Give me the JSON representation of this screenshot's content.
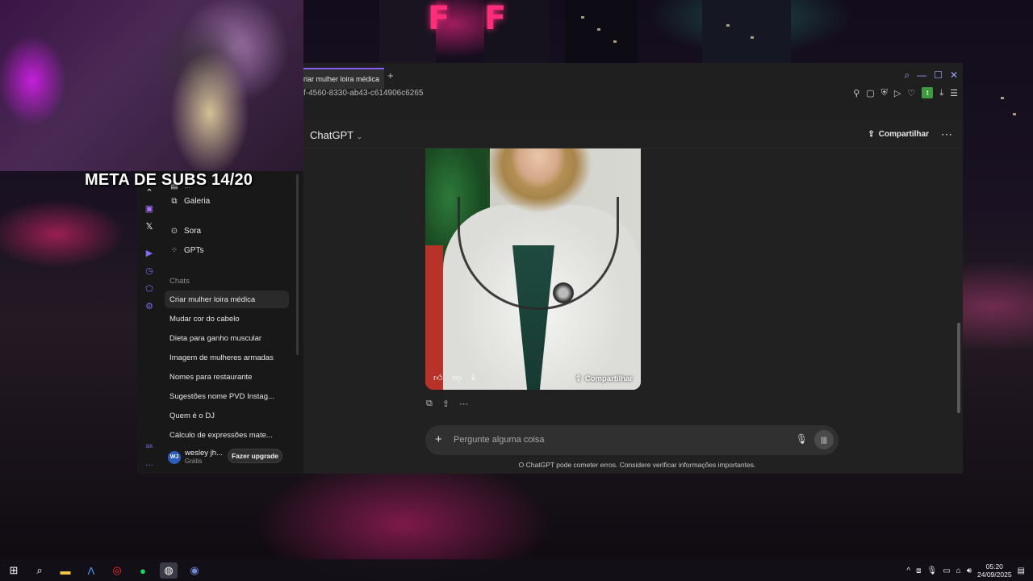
{
  "stream": {
    "subs_goal": "META DE SUBS 14/20"
  },
  "browser": {
    "tab_title": "riar mulher loira médica",
    "url_fragment": "f-4560-8330-ab43-c614906c6265",
    "extension_badge": "t"
  },
  "sidebar": {
    "partial_label": "...",
    "items": [
      {
        "label": "Galeria",
        "icon": "gallery-icon"
      },
      {
        "label": "Sora",
        "icon": "play-circle-icon"
      },
      {
        "label": "GPTs",
        "icon": "grid-icon"
      }
    ],
    "chats_title": "Chats",
    "chats": [
      "Criar mulher loira médica",
      "Mudar cor do cabelo",
      "Dieta para ganho muscular",
      "Imagem de mulheres armadas",
      "Nomes para restaurante",
      "Sugestões nome PVD Instag...",
      "Quem é o DJ",
      "Cálculo de expressões mate..."
    ],
    "user": {
      "initials": "WJ",
      "name": "wesley jh...",
      "plan": "Grátis",
      "upgrade_label": "Fazer upgrade"
    }
  },
  "main": {
    "model_title": "ChatGPT",
    "share_label": "Compartilhar",
    "image_share_label": "Compartilhar",
    "composer_placeholder": "Pergunte alguma coisa",
    "disclaimer": "O ChatGPT pode cometer erros. Considere verificar informações importantes."
  },
  "taskbar": {
    "time": "05:20",
    "date": "24/09/2025"
  }
}
